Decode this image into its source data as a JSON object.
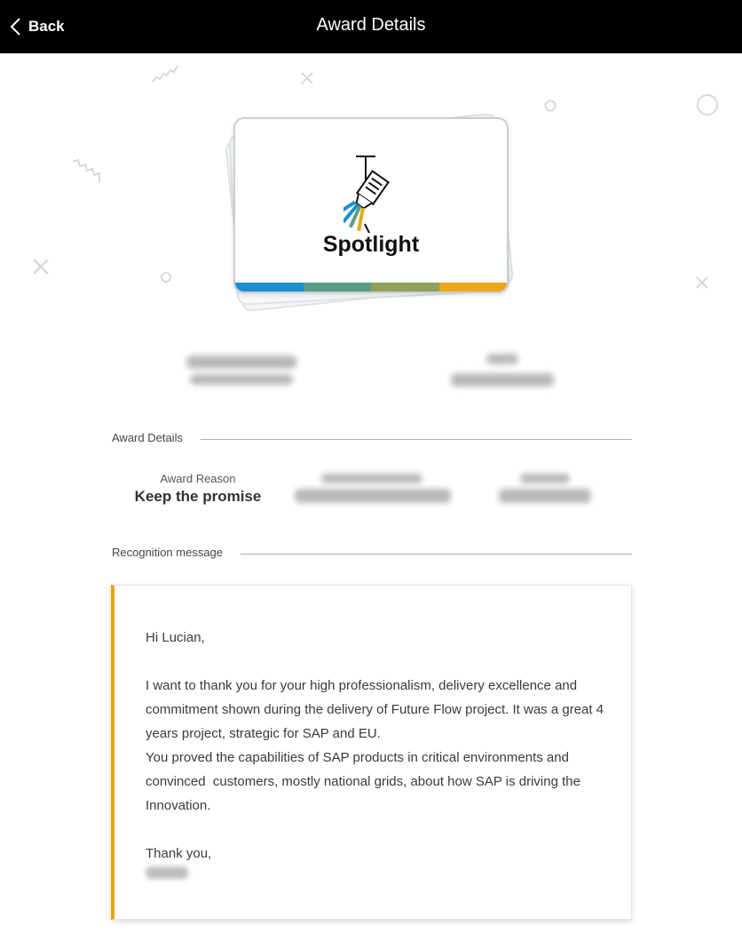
{
  "header": {
    "back_label": "Back",
    "title": "Award Details"
  },
  "award_card": {
    "name": "Spotlight",
    "icon": "spotlight-lamp-icon",
    "stripe_colors": [
      "#1b8fcf",
      "#5a9c84",
      "#8fa15c",
      "#e9a91a"
    ]
  },
  "details_section": {
    "label": "Award Details",
    "reason_label": "Award Reason",
    "reason_value": "Keep the promise"
  },
  "message_section": {
    "label": "Recognition message",
    "text": "Hi Lucian,\n\nI want to thank you for your high professionalism, delivery excellence and commitment shown during the delivery of Future Flow project. It was a great 4 years project, strategic for SAP and EU.\nYou proved the capabilities of SAP products in critical environments and convinced  customers, mostly national grids, about how SAP is driving the Innovation.\n\nThank you,",
    "accent_color": "#e0a800"
  }
}
